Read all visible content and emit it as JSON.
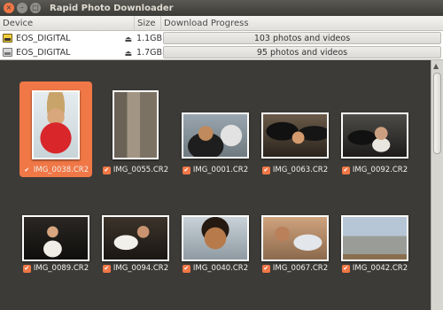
{
  "window": {
    "title": "Rapid Photo Downloader"
  },
  "window_controls": {
    "close": "×",
    "minimize": "–",
    "maximize": "□"
  },
  "device_table": {
    "headers": {
      "device": "Device",
      "size": "Size",
      "progress": "Download Progress"
    },
    "rows": [
      {
        "device": "EOS_DIGITAL",
        "size": "1.1GB",
        "progress": "103 photos and videos",
        "icon": "camera-card-icon"
      },
      {
        "device": "EOS_DIGITAL",
        "size": "1.7GB",
        "progress": "95 photos and videos",
        "icon": "drive-icon"
      }
    ],
    "eject_glyph": "⏏"
  },
  "thumbnails": [
    {
      "filename": "IMG_0038.CR2",
      "selected": true,
      "checked": true
    },
    {
      "filename": "IMG_0055.CR2",
      "selected": false,
      "checked": true
    },
    {
      "filename": "IMG_0001.CR2",
      "selected": false,
      "checked": true
    },
    {
      "filename": "IMG_0063.CR2",
      "selected": false,
      "checked": true
    },
    {
      "filename": "IMG_0092.CR2",
      "selected": false,
      "checked": true
    },
    {
      "filename": "IMG_0089.CR2",
      "selected": false,
      "checked": true
    },
    {
      "filename": "IMG_0094.CR2",
      "selected": false,
      "checked": true
    },
    {
      "filename": "IMG_0040.CR2",
      "selected": false,
      "checked": true
    },
    {
      "filename": "IMG_0067.CR2",
      "selected": false,
      "checked": true
    },
    {
      "filename": "IMG_0042.CR2",
      "selected": false,
      "checked": true
    }
  ],
  "colors": {
    "accent": "#f07746",
    "background": "#3c3b37"
  }
}
